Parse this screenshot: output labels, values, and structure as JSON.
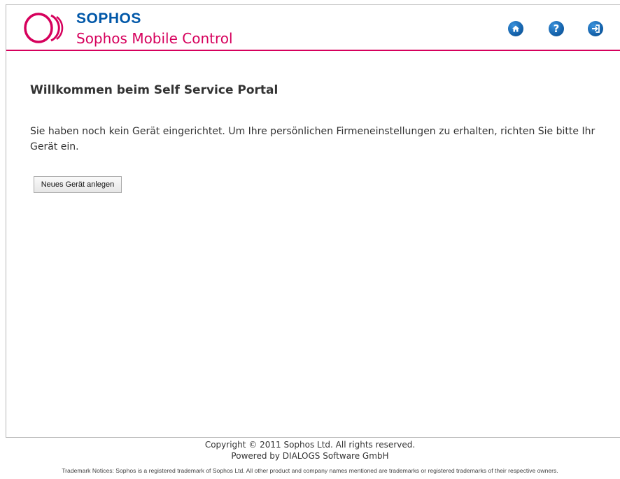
{
  "header": {
    "brand": "SOPHOS",
    "product": "Sophos Mobile Control",
    "icons": {
      "home": "home-icon",
      "help": "help-icon",
      "logout": "logout-icon",
      "help_glyph": "?"
    },
    "colors": {
      "brand_blue": "#0057a8",
      "accent_pink": "#d6005c",
      "icon_blue": "#1563ac"
    }
  },
  "main": {
    "title": "Willkommen beim Self Service Portal",
    "message": "Sie haben noch kein Gerät eingerichtet. Um Ihre persönlichen Firmeneinstellungen zu erhalten, richten Sie bitte Ihr Gerät ein.",
    "new_device_button": "Neues Gerät anlegen"
  },
  "footer": {
    "copyright": "Copyright © 2011 Sophos Ltd. All rights reserved.",
    "powered_by": "Powered by DIALOGS Software GmbH",
    "trademark": "Trademark Notices: Sophos is a registered trademark of Sophos Ltd. All other product and company names mentioned are trademarks or registered trademarks of their respective owners."
  }
}
